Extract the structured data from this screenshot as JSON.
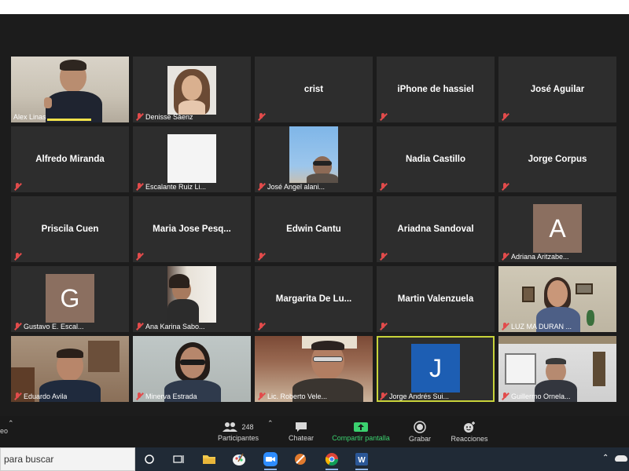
{
  "tiles": [
    {
      "name": "Alex Linas",
      "mode": "video"
    },
    {
      "name": "Denisse Sáenz",
      "mode": "video"
    },
    {
      "name": "crist",
      "mode": "name"
    },
    {
      "name": "iPhone de hassiel",
      "mode": "name"
    },
    {
      "name": "José Aguilar",
      "mode": "name"
    },
    {
      "name": "Alfredo Miranda",
      "mode": "name"
    },
    {
      "name": "Escalante Ruiz Li...",
      "mode": "video"
    },
    {
      "name": "José Angel alani...",
      "mode": "video"
    },
    {
      "name": "Nadia Castillo",
      "mode": "name"
    },
    {
      "name": "Jorge Corpus",
      "mode": "name"
    },
    {
      "name": "Priscila Cuen",
      "mode": "name"
    },
    {
      "name": "Maria Jose Pesq...",
      "mode": "name"
    },
    {
      "name": "Edwin Cantu",
      "mode": "name"
    },
    {
      "name": "Ariadna Sandoval",
      "mode": "name"
    },
    {
      "name": "Adriana Aritzabe...",
      "mode": "avatar",
      "letter": "A"
    },
    {
      "name": "Gustavo E. Escal...",
      "mode": "avatar",
      "letter": "G"
    },
    {
      "name": "Ana Karina Sabo...",
      "mode": "video"
    },
    {
      "name": "Margarita De Lu...",
      "mode": "name"
    },
    {
      "name": "Martin Valenzuela",
      "mode": "name"
    },
    {
      "name": "LUZ MA DURAN ...",
      "mode": "video"
    },
    {
      "name": "Eduardo Avila",
      "mode": "video"
    },
    {
      "name": "Minerva Estrada",
      "mode": "video"
    },
    {
      "name": "Lic. Roberto Vele...",
      "mode": "video"
    },
    {
      "name": "Jorge Andrés Sui...",
      "mode": "avatar",
      "letter": "J",
      "active": true
    },
    {
      "name": "Guillermo Ornela...",
      "mode": "video"
    }
  ],
  "toolbar": {
    "left_fragment": "eo",
    "participants_count": "248",
    "participants_label": "Participantes",
    "chat_label": "Chatear",
    "share_label": "Compartir pantalla",
    "record_label": "Grabar",
    "reactions_label": "Reacciones"
  },
  "taskbar": {
    "search_placeholder": "para buscar",
    "icons": [
      "cortana-circle-icon",
      "task-view-icon",
      "file-explorer-icon",
      "paint-icon",
      "zoom-icon",
      "sketch-app-icon",
      "chrome-icon",
      "word-icon"
    ]
  },
  "colors": {
    "meeting_bg": "#1c1c1c",
    "tile_bg": "#2d2d2d",
    "active_outline": "#c8d33a",
    "share_green": "#3bd16f",
    "muted_red": "#e24b4b",
    "avatar_brown": "#8b6f60",
    "avatar_blue": "#1d5eb3"
  }
}
